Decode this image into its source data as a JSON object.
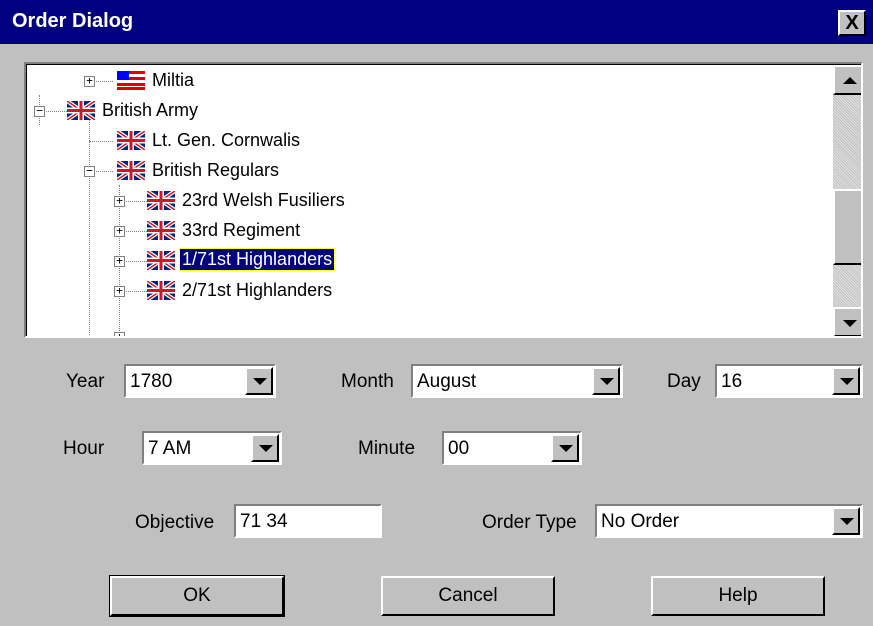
{
  "window": {
    "title": "Order Dialog",
    "close_label": "X"
  },
  "tree": {
    "items": [
      {
        "label": "Miltia",
        "flag": "us-flag-icon",
        "expander": "+"
      },
      {
        "label": "British Army",
        "flag": "uk-flag-icon",
        "expander": "−"
      },
      {
        "label": "Lt. Gen. Cornwalis",
        "flag": "uk-flag-icon",
        "expander": ""
      },
      {
        "label": "British Regulars",
        "flag": "uk-flag-icon",
        "expander": "−"
      },
      {
        "label": "23rd Welsh Fusiliers",
        "flag": "uk-flag-icon",
        "expander": "+"
      },
      {
        "label": "33rd Regiment",
        "flag": "uk-flag-icon",
        "expander": "+"
      },
      {
        "label": "1/71st Highlanders",
        "flag": "uk-flag-icon",
        "expander": "+",
        "selected": true
      },
      {
        "label": "2/71st Highlanders",
        "flag": "uk-flag-icon",
        "expander": "+"
      }
    ]
  },
  "date": {
    "year_label": "Year",
    "year_value": "1780",
    "month_label": "Month",
    "month_value": "August",
    "day_label": "Day",
    "day_value": "16"
  },
  "time": {
    "hour_label": "Hour",
    "hour_value": "7 AM",
    "minute_label": "Minute",
    "minute_value": "00"
  },
  "order": {
    "objective_label": "Objective",
    "objective_value": "71 34",
    "type_label": "Order Type",
    "type_value": "No Order"
  },
  "buttons": {
    "ok": "OK",
    "cancel": "Cancel",
    "help": "Help"
  },
  "colors": {
    "titlebar": "#000080",
    "face": "#c0c0c0",
    "selection": "#000080"
  }
}
